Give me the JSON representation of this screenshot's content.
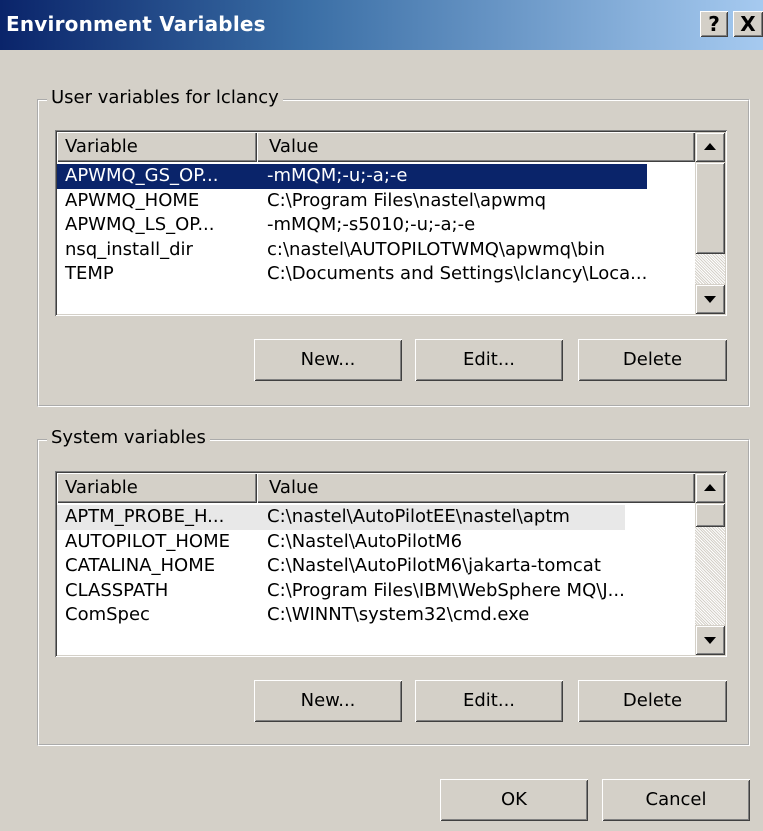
{
  "window": {
    "title": "Environment Variables",
    "help_glyph": "?",
    "close_glyph": "X"
  },
  "user_vars": {
    "group_label": "User variables for lclancy",
    "columns": [
      "Variable",
      "Value"
    ],
    "rows": [
      {
        "variable": "APWMQ_GS_OP...",
        "value": "-mMQM;-u;-a;-e",
        "state": "selected"
      },
      {
        "variable": "APWMQ_HOME",
        "value": "C:\\Program Files\\nastel\\apwmq",
        "state": ""
      },
      {
        "variable": "APWMQ_LS_OP...",
        "value": "-mMQM;-s5010;-u;-a;-e",
        "state": ""
      },
      {
        "variable": "nsq_install_dir",
        "value": "c:\\nastel\\AUTOPILOTWMQ\\apwmq\\bin",
        "state": ""
      },
      {
        "variable": "TEMP",
        "value": "C:\\Documents and Settings\\lclancy\\Loca...",
        "state": ""
      }
    ],
    "buttons": {
      "new": "New...",
      "edit": "Edit...",
      "delete": "Delete"
    }
  },
  "system_vars": {
    "group_label": "System variables",
    "columns": [
      "Variable",
      "Value"
    ],
    "rows": [
      {
        "variable": "APTM_PROBE_H...",
        "value": "C:\\nastel\\AutoPilotEE\\nastel\\aptm",
        "state": "focused"
      },
      {
        "variable": "AUTOPILOT_HOME",
        "value": "C:\\Nastel\\AutoPilotM6",
        "state": ""
      },
      {
        "variable": "CATALINA_HOME",
        "value": "C:\\Nastel\\AutoPilotM6\\jakarta-tomcat",
        "state": ""
      },
      {
        "variable": "CLASSPATH",
        "value": "C:\\Program Files\\IBM\\WebSphere MQ\\J...",
        "state": ""
      },
      {
        "variable": "ComSpec",
        "value": "C:\\WINNT\\system32\\cmd.exe",
        "state": ""
      }
    ],
    "buttons": {
      "new": "New...",
      "edit": "Edit...",
      "delete": "Delete"
    }
  },
  "dialog_buttons": {
    "ok": "OK",
    "cancel": "Cancel"
  },
  "colors": {
    "selection": "#0a246a",
    "face": "#d4d0c8"
  }
}
